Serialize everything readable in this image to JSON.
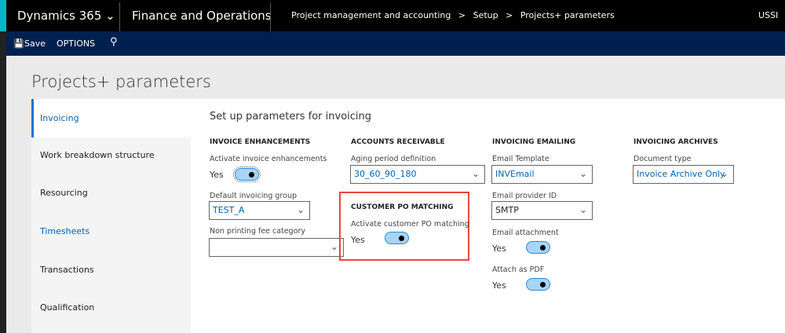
{
  "topbar": {
    "product": "Dynamics 365",
    "app": "Finance and Operations",
    "breadcrumb": [
      "Project management and accounting",
      "Setup",
      "Projects+ parameters"
    ],
    "breadcrumb_sep": ">",
    "company": "USSI"
  },
  "command": {
    "save": "Save",
    "options": "OPTIONS"
  },
  "page_title": "Projects+ parameters",
  "nav": [
    "Invoicing",
    "Work breakdown structure",
    "Resourcing",
    "Timesheets",
    "Transactions",
    "Qualification"
  ],
  "main": {
    "heading": "Set up parameters for invoicing",
    "invoice_enhancements": {
      "title": "INVOICE ENHANCEMENTS",
      "activate_label": "Activate invoice enhancements",
      "activate_value": "Yes",
      "group_label": "Default invoicing group",
      "group_value": "TEST_A",
      "fee_label": "Non printing fee category",
      "fee_value": ""
    },
    "accounts_receivable": {
      "title": "ACCOUNTS RECEIVABLE",
      "aging_label": "Aging period definition",
      "aging_value": "30_60_90_180"
    },
    "po_matching": {
      "title": "CUSTOMER PO MATCHING",
      "activate_label": "Activate customer PO matching",
      "activate_value": "Yes"
    },
    "emailing": {
      "title": "INVOICING EMAILING",
      "template_label": "Email Template",
      "template_value": "INVEmail",
      "provider_label": "Email provider ID",
      "provider_value": "SMTP",
      "attachment_label": "Email attachment",
      "attachment_value": "Yes",
      "pdf_label": "Attach as PDF",
      "pdf_value": "Yes"
    },
    "archives": {
      "title": "INVOICING ARCHIVES",
      "doctype_label": "Document type",
      "doctype_value": "Invoice Archive Only"
    }
  },
  "colors": {
    "accent": "#0078d7",
    "highlight": "#e8453c",
    "command_bar": "#002050"
  }
}
